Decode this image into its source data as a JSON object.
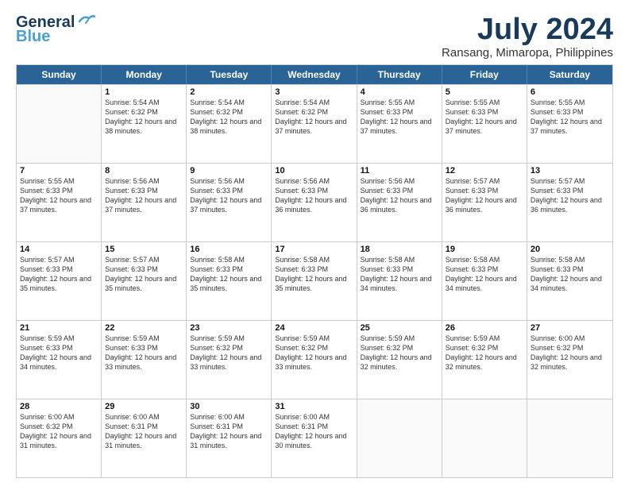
{
  "header": {
    "logo_line1": "General",
    "logo_line2": "Blue",
    "month_title": "July 2024",
    "location": "Ransang, Mimaropa, Philippines"
  },
  "days_of_week": [
    "Sunday",
    "Monday",
    "Tuesday",
    "Wednesday",
    "Thursday",
    "Friday",
    "Saturday"
  ],
  "weeks": [
    [
      {
        "day": "",
        "empty": true
      },
      {
        "day": "1",
        "sunrise": "Sunrise: 5:54 AM",
        "sunset": "Sunset: 6:32 PM",
        "daylight": "Daylight: 12 hours and 38 minutes."
      },
      {
        "day": "2",
        "sunrise": "Sunrise: 5:54 AM",
        "sunset": "Sunset: 6:32 PM",
        "daylight": "Daylight: 12 hours and 38 minutes."
      },
      {
        "day": "3",
        "sunrise": "Sunrise: 5:54 AM",
        "sunset": "Sunset: 6:32 PM",
        "daylight": "Daylight: 12 hours and 37 minutes."
      },
      {
        "day": "4",
        "sunrise": "Sunrise: 5:55 AM",
        "sunset": "Sunset: 6:33 PM",
        "daylight": "Daylight: 12 hours and 37 minutes."
      },
      {
        "day": "5",
        "sunrise": "Sunrise: 5:55 AM",
        "sunset": "Sunset: 6:33 PM",
        "daylight": "Daylight: 12 hours and 37 minutes."
      },
      {
        "day": "6",
        "sunrise": "Sunrise: 5:55 AM",
        "sunset": "Sunset: 6:33 PM",
        "daylight": "Daylight: 12 hours and 37 minutes."
      }
    ],
    [
      {
        "day": "7",
        "sunrise": "Sunrise: 5:55 AM",
        "sunset": "Sunset: 6:33 PM",
        "daylight": "Daylight: 12 hours and 37 minutes."
      },
      {
        "day": "8",
        "sunrise": "Sunrise: 5:56 AM",
        "sunset": "Sunset: 6:33 PM",
        "daylight": "Daylight: 12 hours and 37 minutes."
      },
      {
        "day": "9",
        "sunrise": "Sunrise: 5:56 AM",
        "sunset": "Sunset: 6:33 PM",
        "daylight": "Daylight: 12 hours and 37 minutes."
      },
      {
        "day": "10",
        "sunrise": "Sunrise: 5:56 AM",
        "sunset": "Sunset: 6:33 PM",
        "daylight": "Daylight: 12 hours and 36 minutes."
      },
      {
        "day": "11",
        "sunrise": "Sunrise: 5:56 AM",
        "sunset": "Sunset: 6:33 PM",
        "daylight": "Daylight: 12 hours and 36 minutes."
      },
      {
        "day": "12",
        "sunrise": "Sunrise: 5:57 AM",
        "sunset": "Sunset: 6:33 PM",
        "daylight": "Daylight: 12 hours and 36 minutes."
      },
      {
        "day": "13",
        "sunrise": "Sunrise: 5:57 AM",
        "sunset": "Sunset: 6:33 PM",
        "daylight": "Daylight: 12 hours and 36 minutes."
      }
    ],
    [
      {
        "day": "14",
        "sunrise": "Sunrise: 5:57 AM",
        "sunset": "Sunset: 6:33 PM",
        "daylight": "Daylight: 12 hours and 35 minutes."
      },
      {
        "day": "15",
        "sunrise": "Sunrise: 5:57 AM",
        "sunset": "Sunset: 6:33 PM",
        "daylight": "Daylight: 12 hours and 35 minutes."
      },
      {
        "day": "16",
        "sunrise": "Sunrise: 5:58 AM",
        "sunset": "Sunset: 6:33 PM",
        "daylight": "Daylight: 12 hours and 35 minutes."
      },
      {
        "day": "17",
        "sunrise": "Sunrise: 5:58 AM",
        "sunset": "Sunset: 6:33 PM",
        "daylight": "Daylight: 12 hours and 35 minutes."
      },
      {
        "day": "18",
        "sunrise": "Sunrise: 5:58 AM",
        "sunset": "Sunset: 6:33 PM",
        "daylight": "Daylight: 12 hours and 34 minutes."
      },
      {
        "day": "19",
        "sunrise": "Sunrise: 5:58 AM",
        "sunset": "Sunset: 6:33 PM",
        "daylight": "Daylight: 12 hours and 34 minutes."
      },
      {
        "day": "20",
        "sunrise": "Sunrise: 5:58 AM",
        "sunset": "Sunset: 6:33 PM",
        "daylight": "Daylight: 12 hours and 34 minutes."
      }
    ],
    [
      {
        "day": "21",
        "sunrise": "Sunrise: 5:59 AM",
        "sunset": "Sunset: 6:33 PM",
        "daylight": "Daylight: 12 hours and 34 minutes."
      },
      {
        "day": "22",
        "sunrise": "Sunrise: 5:59 AM",
        "sunset": "Sunset: 6:33 PM",
        "daylight": "Daylight: 12 hours and 33 minutes."
      },
      {
        "day": "23",
        "sunrise": "Sunrise: 5:59 AM",
        "sunset": "Sunset: 6:32 PM",
        "daylight": "Daylight: 12 hours and 33 minutes."
      },
      {
        "day": "24",
        "sunrise": "Sunrise: 5:59 AM",
        "sunset": "Sunset: 6:32 PM",
        "daylight": "Daylight: 12 hours and 33 minutes."
      },
      {
        "day": "25",
        "sunrise": "Sunrise: 5:59 AM",
        "sunset": "Sunset: 6:32 PM",
        "daylight": "Daylight: 12 hours and 32 minutes."
      },
      {
        "day": "26",
        "sunrise": "Sunrise: 5:59 AM",
        "sunset": "Sunset: 6:32 PM",
        "daylight": "Daylight: 12 hours and 32 minutes."
      },
      {
        "day": "27",
        "sunrise": "Sunrise: 6:00 AM",
        "sunset": "Sunset: 6:32 PM",
        "daylight": "Daylight: 12 hours and 32 minutes."
      }
    ],
    [
      {
        "day": "28",
        "sunrise": "Sunrise: 6:00 AM",
        "sunset": "Sunset: 6:32 PM",
        "daylight": "Daylight: 12 hours and 31 minutes."
      },
      {
        "day": "29",
        "sunrise": "Sunrise: 6:00 AM",
        "sunset": "Sunset: 6:31 PM",
        "daylight": "Daylight: 12 hours and 31 minutes."
      },
      {
        "day": "30",
        "sunrise": "Sunrise: 6:00 AM",
        "sunset": "Sunset: 6:31 PM",
        "daylight": "Daylight: 12 hours and 31 minutes."
      },
      {
        "day": "31",
        "sunrise": "Sunrise: 6:00 AM",
        "sunset": "Sunset: 6:31 PM",
        "daylight": "Daylight: 12 hours and 30 minutes."
      },
      {
        "day": "",
        "empty": true
      },
      {
        "day": "",
        "empty": true
      },
      {
        "day": "",
        "empty": true
      }
    ]
  ]
}
